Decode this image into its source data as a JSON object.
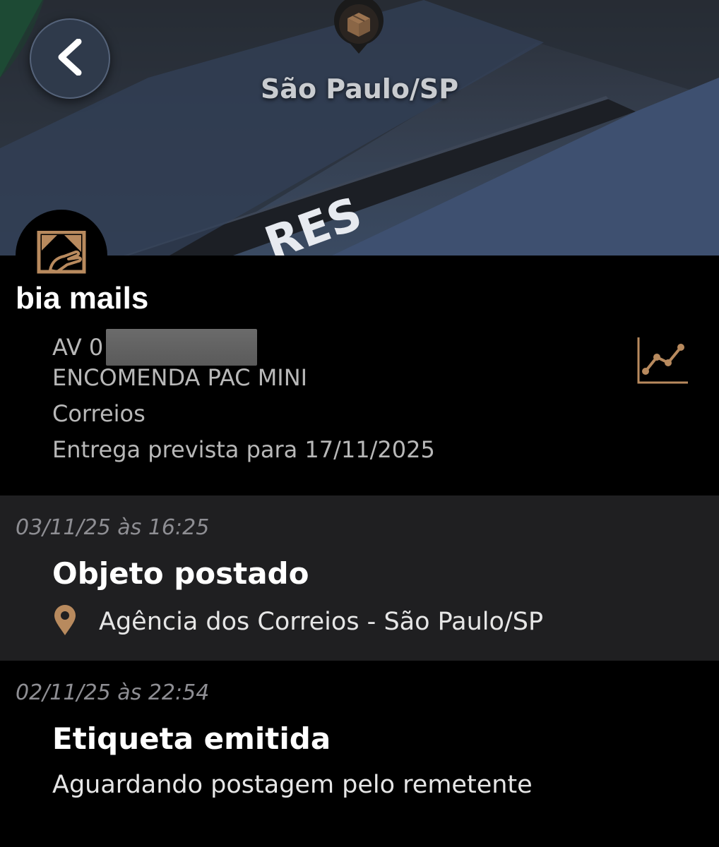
{
  "header": {
    "city": "São Paulo/SP",
    "map_street_fragment": "RES",
    "accent_color": "#b88a5e"
  },
  "shipment": {
    "store_name": "bia mails",
    "tracking_code_prefix": "AV 0",
    "service": "ENCOMENDA PAC MINI",
    "carrier": "Correios",
    "delivery_estimate": "Entrega prevista para 17/11/2025"
  },
  "events": [
    {
      "datetime": "03/11/25 às 16:25",
      "title": "Objeto postado",
      "location": "Agência dos Correios - São Paulo/SP",
      "icon": "location-pin-icon"
    },
    {
      "datetime": "02/11/25 às 22:54",
      "title": "Etiqueta emitida",
      "description": "Aguardando postagem pelo remetente"
    }
  ]
}
